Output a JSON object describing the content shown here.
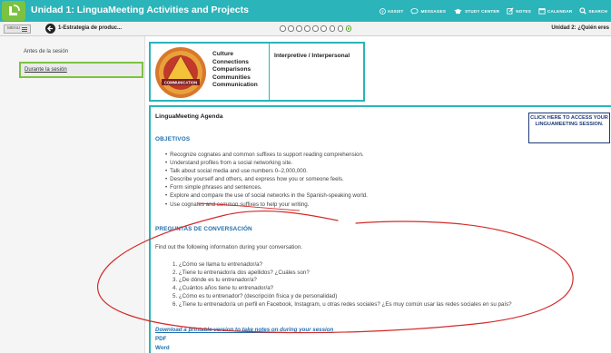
{
  "header": {
    "title": "Unidad 1: LinguaMeeting Activities and Projects",
    "nav": [
      "ASSIST",
      "MESSAGES",
      "STUDY CENTER",
      "NOTES",
      "CALENDAR",
      "SEARCH"
    ]
  },
  "subbar": {
    "menu_label": "MENU",
    "lesson_title": "1-Estrategia de produc...",
    "unit_title": "Unidad 2: ¿Quién eres"
  },
  "sidebar": {
    "items": [
      {
        "label": "Antes de la sesión"
      },
      {
        "label": "Durante la sesión"
      }
    ]
  },
  "communication": {
    "emblem_text": "COMMUNICATION",
    "c_list": [
      "Culture",
      "Connections",
      "Comparisons",
      "Communities",
      "Communication"
    ],
    "modes": "Interpretive / Interpersonal"
  },
  "agenda": {
    "title": "LinguaMeeting Agenda",
    "access_button": "CLICK HERE TO ACCESS YOUR LINGUAMEETING SESSION.",
    "objetivos_heading": "OBJETIVOS",
    "objetivos": [
      "Recognize cognates and common suffixes to support reading comprehension.",
      "Understand profiles from a social networking site.",
      "Talk about social media and use numbers 0–2,000,000.",
      "Describe yourself and others, and express how you or someone feels.",
      "Form simple phrases and sentences.",
      "Explore and compare the use of social networks in the Spanish-speaking world.",
      "Use cognates and common suffixes to help your writing."
    ],
    "preguntas_heading": "PREGUNTAS DE CONVERSACIÓN",
    "find_out": "Find out the following information during your conversation.",
    "questions": [
      "1. ¿Cómo se llama tu entrenador/a?",
      "2. ¿Tiene tu entrenador/a dos apellidos? ¿Cuáles son?",
      "3. ¿De dónde es tu entrenador/a?",
      "4. ¿Cuántos años tiene tu entrenador/a?",
      "5. ¿Cómo es tu entrenador? (descripción física y de personalidad)",
      "6. ¿Tiene tu entrenador/a un perfil en Facebook, Instagram, u otras redes sociales? ¿Es muy común usar las redes sociales en su país?"
    ],
    "download_text": "Download a printable version to take notes on during your session",
    "links": [
      "PDF",
      "Word"
    ]
  },
  "colors": {
    "topbar": "#2bb4ba",
    "logo": "#7cc242",
    "heading_blue": "#1f6fae",
    "annotation_red": "#d42a2a"
  },
  "icons": [
    "logo-icon",
    "assist-icon",
    "messages-icon",
    "study-center-icon",
    "notes-icon",
    "calendar-icon",
    "search-icon",
    "hamburger-icon",
    "back-arrow-icon",
    "communication-emblem"
  ]
}
